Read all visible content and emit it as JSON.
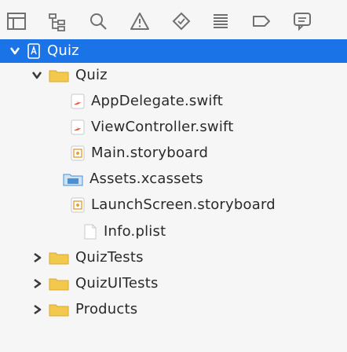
{
  "toolbar": {
    "icons": [
      "folder-icon",
      "hierarchy-icon",
      "search-icon",
      "warning-icon",
      "breakpoint-icon",
      "list-icon",
      "tag-icon",
      "chat-icon"
    ]
  },
  "navigator": {
    "selected": {
      "label": "Quiz"
    },
    "tree": [
      {
        "label": "Quiz",
        "type": "group",
        "expanded": true
      },
      {
        "label": "AppDelegate.swift",
        "type": "swift"
      },
      {
        "label": "ViewController.swift",
        "type": "swift"
      },
      {
        "label": "Main.storyboard",
        "type": "storyboard"
      },
      {
        "label": "Assets.xcassets",
        "type": "assets"
      },
      {
        "label": "LaunchScreen.storyboard",
        "type": "storyboard"
      },
      {
        "label": "Info.plist",
        "type": "plist"
      },
      {
        "label": "QuizTests",
        "type": "group",
        "expanded": false
      },
      {
        "label": "QuizUITests",
        "type": "group",
        "expanded": false
      },
      {
        "label": "Products",
        "type": "group",
        "expanded": false
      }
    ]
  },
  "colors": {
    "selection": "#1b73e8",
    "folder": "#f2c94c",
    "swift": "#f05138",
    "storyboard": "#e4a33a",
    "assets": "#4a90d9"
  }
}
